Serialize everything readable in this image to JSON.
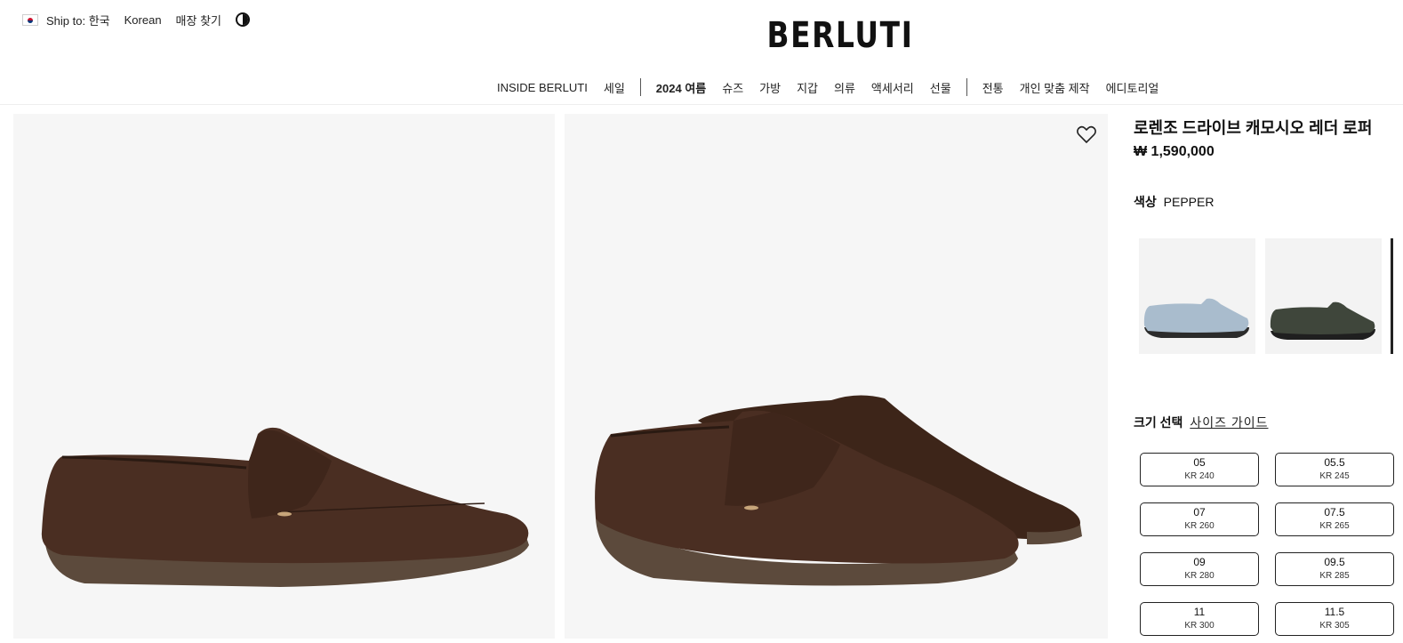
{
  "topbar": {
    "ship_to": "Ship to: 한국",
    "language": "Korean",
    "store_locator": "매장 찾기",
    "contrast_icon": "contrast-icon"
  },
  "brand": {
    "logo": "BERLUTI"
  },
  "nav": {
    "items": [
      "INSIDE BERLUTI",
      "세일",
      "2024 여름",
      "슈즈",
      "가방",
      "지갑",
      "의류",
      "액세서리",
      "선물",
      "전통",
      "개인 맞춤 제작",
      "에디토리얼"
    ]
  },
  "product": {
    "title": "로렌조 드라이브 캐모시오 레더 로퍼",
    "price": "₩ 1,590,000",
    "color_label": "색상",
    "color_value": "PEPPER",
    "wishlist_icon": "heart-icon",
    "colors": {
      "main": "#4a2e22",
      "swatch_1": "#a9bccd",
      "swatch_2": "#3f463b"
    }
  },
  "size": {
    "label": "크기 선택",
    "guide": "사이즈 가이드",
    "options": [
      {
        "size": "05",
        "kr": "KR 240"
      },
      {
        "size": "05.5",
        "kr": "KR 245"
      },
      {
        "size": "07",
        "kr": "KR 260"
      },
      {
        "size": "07.5",
        "kr": "KR 265"
      },
      {
        "size": "09",
        "kr": "KR 280"
      },
      {
        "size": "09.5",
        "kr": "KR 285"
      },
      {
        "size": "11",
        "kr": "KR 300"
      },
      {
        "size": "11.5",
        "kr": "KR 305"
      }
    ]
  }
}
